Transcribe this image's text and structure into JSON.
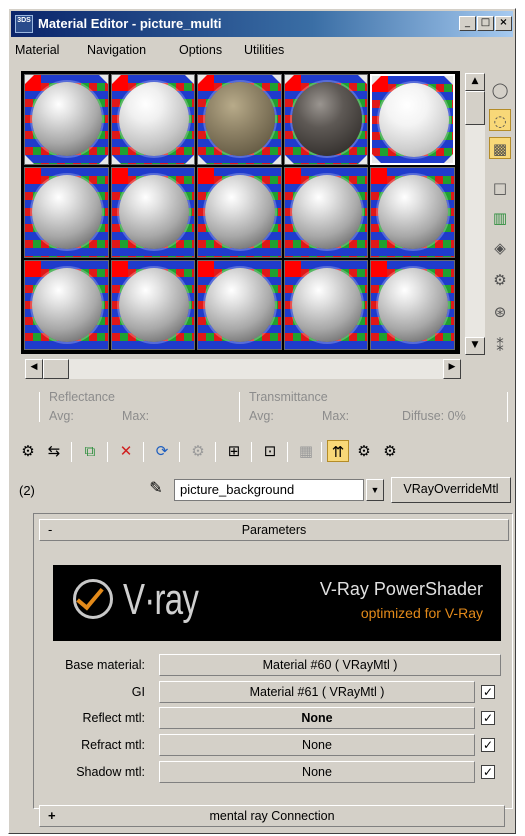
{
  "window": {
    "title": "Material Editor - picture_multi",
    "app_icon_text": "3DS",
    "minimize": "_",
    "maximize": "□",
    "close": "×"
  },
  "menu": [
    "Material",
    "Navigation",
    "Options",
    "Utilities"
  ],
  "slots": {
    "rows": 3,
    "cols": 5,
    "row1_types": [
      "plain",
      "rough",
      "stone",
      "dark",
      "white-active"
    ]
  },
  "scroll": {
    "up": "▲",
    "down": "▼",
    "left": "◀",
    "right": "▶"
  },
  "right_toolbar": [
    "sample-type",
    "backlight",
    "background",
    "uv-tiling",
    "video-color-check",
    "make-preview",
    "options",
    "select-by-material",
    "material-map-navigator"
  ],
  "reflectance": {
    "reflectance_label": "Reflectance",
    "transmittance_label": "Transmittance",
    "avg1": "Avg:",
    "max1": "Max:",
    "avg2": "Avg:",
    "max2": "Max:",
    "diffuse": "Diffuse: 0%"
  },
  "name_row": {
    "slot_index": "(2)",
    "material_name": "picture_background",
    "type_button": "VRayOverrideMtl"
  },
  "parameters": {
    "collapse": "-",
    "header": "Parameters",
    "banner_title": "V-Ray PowerShader",
    "banner_sub": "optimized for V-Ray",
    "banner_logo": "V·ray",
    "base_label": "Base material:",
    "base_value": "Material #60  ( VRayMtl )",
    "gi_label": "GI",
    "gi_value": "Material #61  ( VRayMtl )",
    "gi_checked": "☑",
    "reflect_label": "Reflect mtl:",
    "reflect_value": "None",
    "refract_label": "Refract mtl:",
    "refract_value": "None",
    "shadow_label": "Shadow mtl:",
    "shadow_value": "None",
    "check_mark": "✓"
  },
  "mental_ray": {
    "expand": "+",
    "header": "mental ray Connection"
  }
}
